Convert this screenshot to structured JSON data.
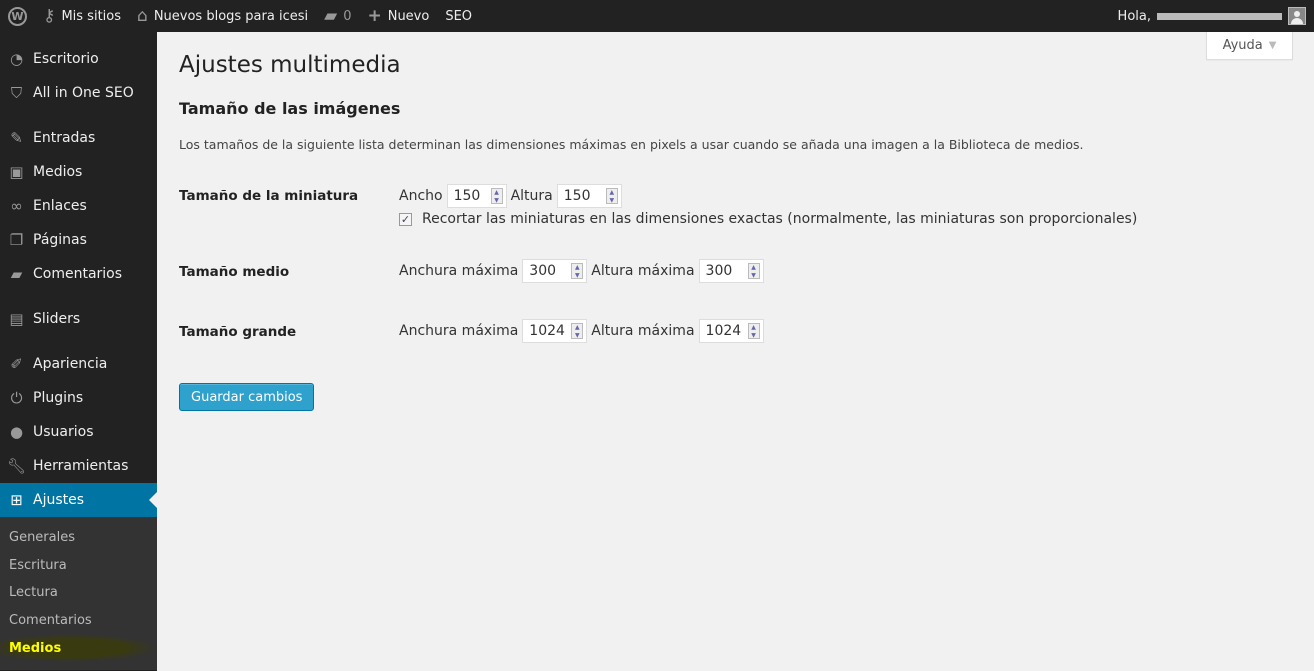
{
  "adminbar": {
    "sites": "Mis sitios",
    "blog": "Nuevos blogs para icesi",
    "comments": "0",
    "new": "Nuevo",
    "seo": "SEO",
    "greeting": "Hola,"
  },
  "sidebar": {
    "items": [
      "Escritorio",
      "All in One SEO",
      "Entradas",
      "Medios",
      "Enlaces",
      "Páginas",
      "Comentarios",
      "Sliders",
      "Apariencia",
      "Plugins",
      "Usuarios",
      "Herramientas",
      "Ajustes"
    ],
    "submenu": [
      "Generales",
      "Escritura",
      "Lectura",
      "Comentarios",
      "Medios"
    ]
  },
  "help": "Ayuda",
  "page": {
    "title": "Ajustes multimedia",
    "section": "Tamaño de las imágenes",
    "description": "Los tamaños de la siguiente lista determinan las dimensiones máximas en pixels a usar cuando se añada una imagen a la Biblioteca de medios.",
    "thumb": {
      "label": "Tamaño de la miniatura",
      "w_label": "Ancho",
      "w": "150",
      "h_label": "Altura",
      "h": "150",
      "crop": "Recortar las miniaturas en las dimensiones exactas (normalmente, las miniaturas son proporcionales)",
      "crop_checked": true
    },
    "medium": {
      "label": "Tamaño medio",
      "w_label": "Anchura máxima",
      "w": "300",
      "h_label": "Altura máxima",
      "h": "300"
    },
    "large": {
      "label": "Tamaño grande",
      "w_label": "Anchura máxima",
      "w": "1024",
      "h_label": "Altura máxima",
      "h": "1024"
    },
    "save": "Guardar cambios"
  }
}
